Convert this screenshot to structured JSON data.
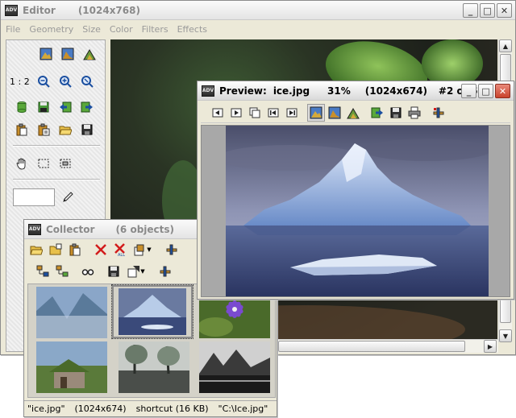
{
  "editor": {
    "title": "Editor",
    "dimensions": "(1024x768)",
    "menu": [
      "File",
      "Geometry",
      "Size",
      "Color",
      "Filters",
      "Effects"
    ],
    "zoom_label": "1 : 2"
  },
  "preview": {
    "title": "Preview:",
    "filename": "ice.jpg",
    "zoom": "31%",
    "dimensions": "(1024x674)",
    "position": "#2 of 6"
  },
  "collector": {
    "title": "Collector",
    "count": "(6 objects)",
    "thumbnails": [
      "misty-mountains",
      "iceberg",
      "purple-flower",
      "old-house",
      "lake-trees",
      "black-white-landscape"
    ],
    "status": {
      "file": "\"ice.jpg\"",
      "dims": "(1024x674)",
      "info": "shortcut (16 KB)",
      "path": "\"C:\\Ice.jpg\""
    }
  },
  "colors": {
    "window_bg": "#ece9d8",
    "close_red": "#c9422c",
    "accent_green": "#3a8a3a"
  }
}
